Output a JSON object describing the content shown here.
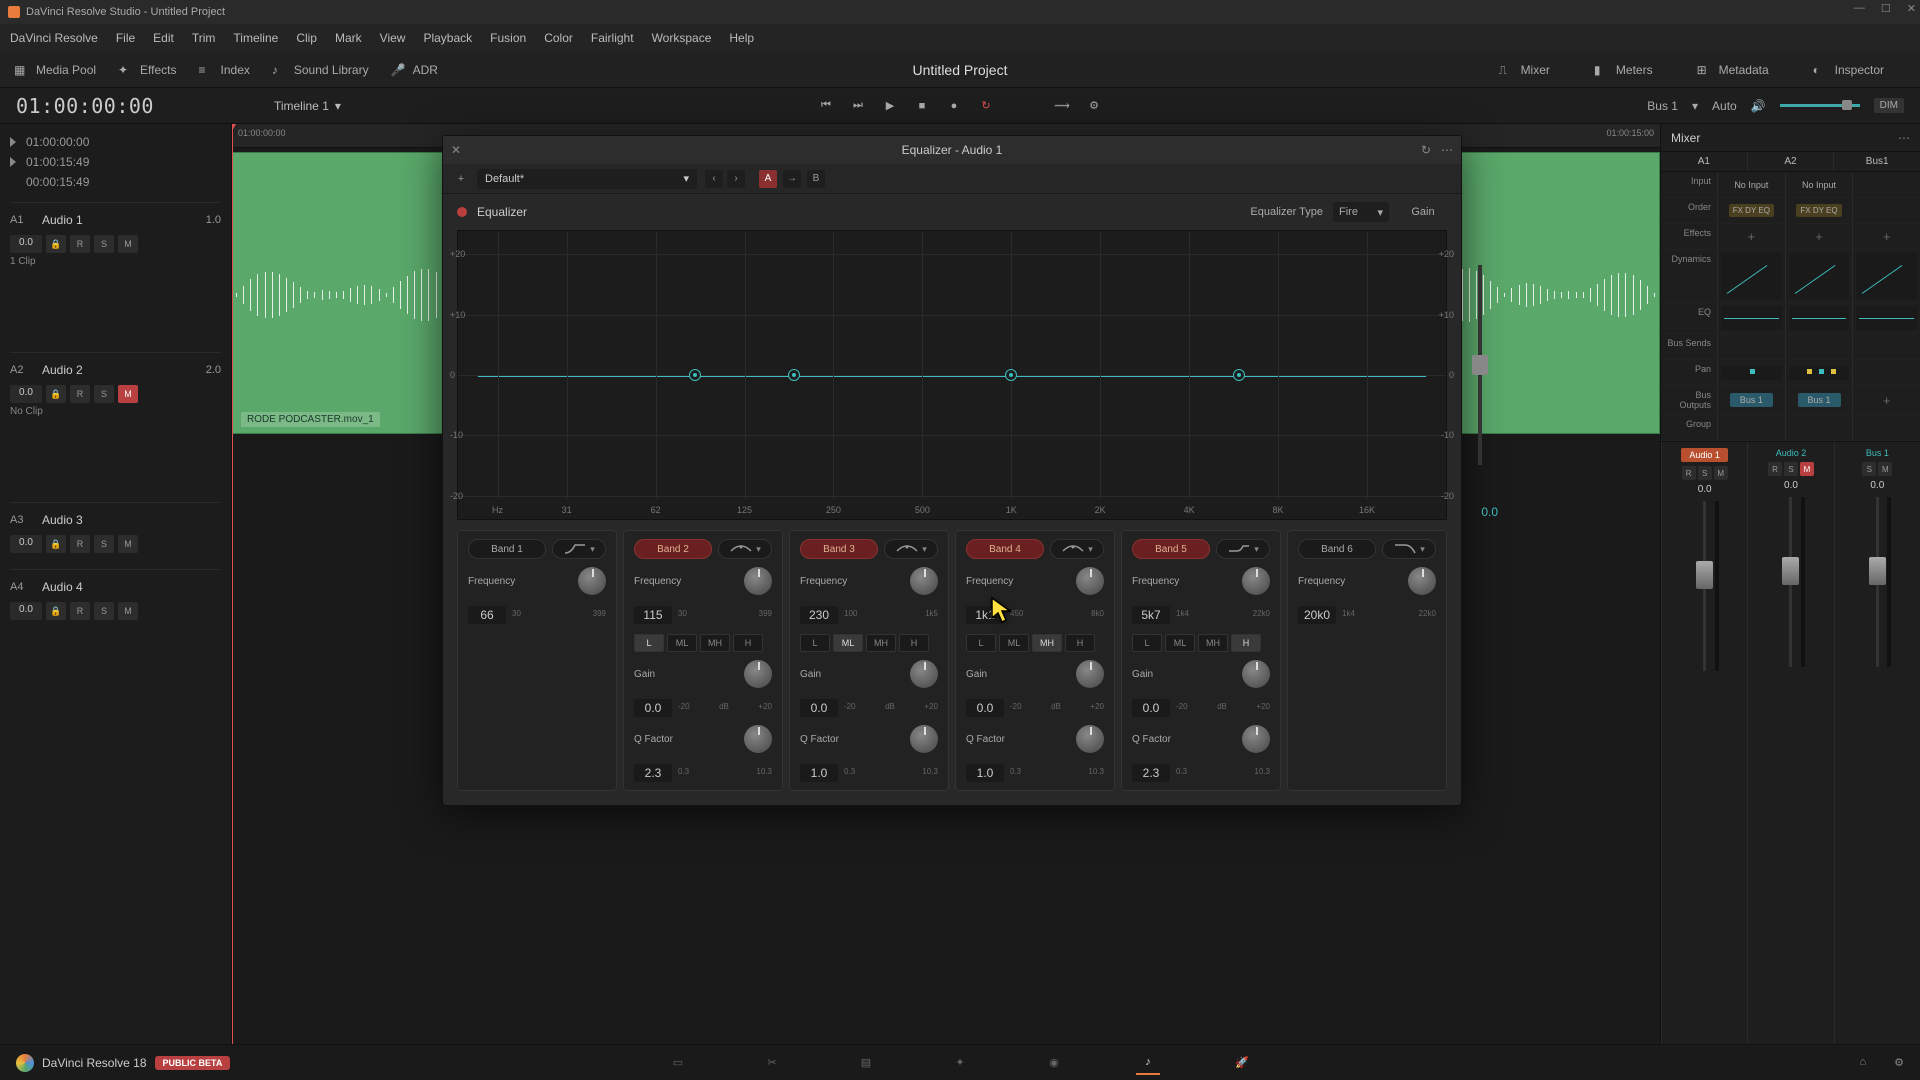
{
  "app": {
    "title": "DaVinci Resolve Studio - Untitled Project"
  },
  "menu": [
    "DaVinci Resolve",
    "File",
    "Edit",
    "Trim",
    "Timeline",
    "Clip",
    "Mark",
    "View",
    "Playback",
    "Fusion",
    "Color",
    "Fairlight",
    "Workspace",
    "Help"
  ],
  "toolbar": {
    "media_pool": "Media Pool",
    "effects": "Effects",
    "index": "Index",
    "sound_library": "Sound Library",
    "adr": "ADR",
    "mixer": "Mixer",
    "meters": "Meters",
    "metadata": "Metadata",
    "inspector": "Inspector"
  },
  "project_title": "Untitled Project",
  "timeline": {
    "timecode": "01:00:00:00",
    "name": "Timeline 1",
    "bus": "Bus 1",
    "auto": "Auto",
    "dim": "DIM",
    "markers": [
      {
        "tc": "01:00:00:00"
      },
      {
        "tc": "01:00:15:49"
      },
      {
        "tc": "00:00:15:49"
      }
    ],
    "ruler_left": "01:00:00:00",
    "ruler_right": "01:00:15:00"
  },
  "tracks": [
    {
      "num": "A1",
      "name": "Audio 1",
      "val": "1.0",
      "zero": "0.0",
      "clips": "1 Clip",
      "m": false
    },
    {
      "num": "A2",
      "name": "Audio 2",
      "val": "2.0",
      "zero": "0.0",
      "clips": "No Clip",
      "m": true
    },
    {
      "num": "A3",
      "name": "Audio 3",
      "val": "",
      "zero": "0.0",
      "clips": "",
      "m": false
    },
    {
      "num": "A4",
      "name": "Audio 4",
      "val": "",
      "zero": "0.0",
      "clips": "",
      "m": false
    }
  ],
  "clip": {
    "label": "RODE PODCASTER.mov_1"
  },
  "eq": {
    "window_title": "Equalizer - Audio 1",
    "preset": "Default*",
    "name": "Equalizer",
    "type_label": "Equalizer Type",
    "type": "Fire",
    "gain_label": "Gain",
    "gain": "0.0",
    "y_ticks": [
      "+20",
      "+10",
      "0",
      "-10",
      "-20"
    ],
    "x_ticks": [
      "Hz",
      "31",
      "62",
      "125",
      "250",
      "500",
      "1K",
      "2K",
      "4K",
      "8K",
      "16K"
    ],
    "points_pct": [
      24,
      34,
      56,
      79
    ],
    "bands": [
      {
        "name": "Band 1",
        "active": false,
        "filter": "hp",
        "freq_label": "Frequency",
        "freq": "66",
        "lo": "30",
        "hi": "399"
      },
      {
        "name": "Band 2",
        "active": true,
        "filter": "bell",
        "freq_label": "Frequency",
        "freq": "115",
        "lo": "30",
        "hi": "399",
        "lmh": [
          "L",
          "ML",
          "MH",
          "H"
        ],
        "lmh_sel": 0,
        "gain_label": "Gain",
        "gain": "0.0",
        "g_lo": "-20",
        "g_mid": "dB",
        "g_hi": "+20",
        "q_label": "Q Factor",
        "q": "2.3",
        "q_lo": "0.3",
        "q_hi": "10.3"
      },
      {
        "name": "Band 3",
        "active": true,
        "filter": "bell",
        "freq_label": "Frequency",
        "freq": "230",
        "lo": "100",
        "hi": "1k5",
        "lmh": [
          "L",
          "ML",
          "MH",
          "H"
        ],
        "lmh_sel": 1,
        "gain_label": "Gain",
        "gain": "0.0",
        "g_lo": "-20",
        "g_mid": "dB",
        "g_hi": "+20",
        "q_label": "Q Factor",
        "q": "1.0",
        "q_lo": "0.3",
        "q_hi": "10.3"
      },
      {
        "name": "Band 4",
        "active": true,
        "filter": "bell",
        "freq_label": "Frequency",
        "freq": "1k1",
        "lo": "450",
        "hi": "8k0",
        "lmh": [
          "L",
          "ML",
          "MH",
          "H"
        ],
        "lmh_sel": 2,
        "gain_label": "Gain",
        "gain": "0.0",
        "g_lo": "-20",
        "g_mid": "dB",
        "g_hi": "+20",
        "q_label": "Q Factor",
        "q": "1.0",
        "q_lo": "0.3",
        "q_hi": "10.3"
      },
      {
        "name": "Band 5",
        "active": true,
        "filter": "shelf",
        "freq_label": "Frequency",
        "freq": "5k7",
        "lo": "1k4",
        "hi": "22k0",
        "lmh": [
          "L",
          "ML",
          "MH",
          "H"
        ],
        "lmh_sel": 3,
        "gain_label": "Gain",
        "gain": "0.0",
        "g_lo": "-20",
        "g_mid": "dB",
        "g_hi": "+20",
        "q_label": "Q Factor",
        "q": "2.3",
        "q_lo": "0.3",
        "q_hi": "10.3"
      },
      {
        "name": "Band 6",
        "active": false,
        "filter": "lp",
        "freq_label": "Frequency",
        "freq": "20k0",
        "lo": "1k4",
        "hi": "22k0"
      }
    ]
  },
  "mixer": {
    "title": "Mixer",
    "channels": [
      "A1",
      "A2",
      "Bus1"
    ],
    "input_label": "Input",
    "inputs": [
      "No Input",
      "No Input",
      ""
    ],
    "order_label": "Order",
    "order": "FX DY EQ",
    "effects_label": "Effects",
    "dynamics_label": "Dynamics",
    "eq_label": "EQ",
    "bus_sends_label": "Bus Sends",
    "pan_label": "Pan",
    "bus_outputs_label": "Bus Outputs",
    "bus_chip": "Bus 1",
    "group_label": "Group",
    "fader_names": [
      "Audio 1",
      "Audio 2",
      "Bus 1"
    ],
    "fader_vals": [
      "0.0",
      "0.0",
      "0.0"
    ]
  },
  "bottom": {
    "app": "DaVinci Resolve 18",
    "beta": "PUBLIC BETA"
  }
}
